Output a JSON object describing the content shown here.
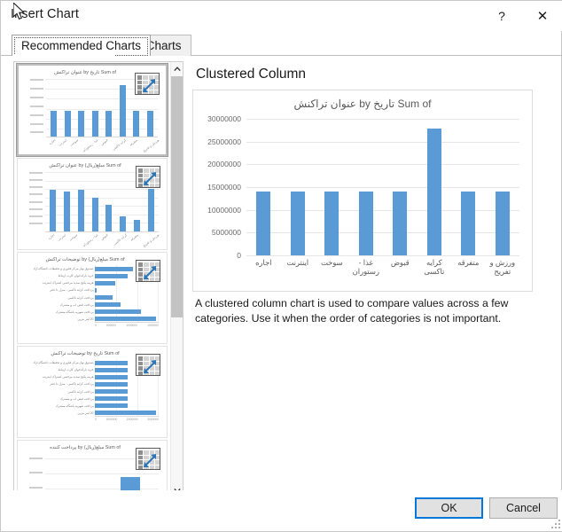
{
  "window": {
    "title": "Insert Chart",
    "help_label": "?",
    "close_label": "✕"
  },
  "tabs": [
    {
      "label": "Recommended Charts",
      "active": true
    },
    {
      "label": "All Charts",
      "active": false
    }
  ],
  "preview": {
    "heading": "Clustered Column",
    "description": "A clustered column chart is used to compare values across a few categories. Use it when the order of categories is not important."
  },
  "buttons": {
    "ok": "OK",
    "cancel": "Cancel"
  },
  "scrollbar": {
    "up_icon": "chevron-up-icon",
    "down_icon": "chevron-down-icon"
  },
  "thumbnails": [
    {
      "title": "Sum of تاریخ by عنوان تراکنش",
      "type": "column",
      "selected": true
    },
    {
      "title": "Sum of مبلغ(ریال) by عنوان تراکنش",
      "type": "column",
      "selected": false
    },
    {
      "title": "Sum of مبلغ(ریال) by توضیحات تراکنش",
      "type": "bar",
      "selected": false
    },
    {
      "title": "Sum of تاریخ by توضیحات تراکنش",
      "type": "bar",
      "selected": false
    },
    {
      "title": "Sum of مبلغ(ریال) by پرداخت کننده",
      "type": "column",
      "selected": false
    }
  ],
  "colors": {
    "series": "#5b9bd5",
    "accent": "#0078d7",
    "gridline": "#e6e6e6",
    "axis_text": "#6b6b6b"
  },
  "chart_data": {
    "type": "bar",
    "title": "Sum of تاریخ by عنوان تراکنش",
    "xlabel": "",
    "ylabel": "",
    "ylim": [
      0,
      30000000
    ],
    "ytick_labels": [
      "0",
      "5000000",
      "10000000",
      "15000000",
      "20000000",
      "25000000",
      "30000000"
    ],
    "ytick_values": [
      0,
      5000000,
      10000000,
      15000000,
      20000000,
      25000000,
      30000000
    ],
    "grid": true,
    "legend": false,
    "categories": [
      "اجاره",
      "اینترنت",
      "سوخت",
      "غذا - رستوران",
      "قبوض",
      "کرایه تاکسی",
      "متفرقه",
      "ورزش و تفریح"
    ],
    "values": [
      13950000,
      13950000,
      13950000,
      13950000,
      13950000,
      27800000,
      13950000,
      13950000
    ],
    "series": [
      {
        "name": "Sum of تاریخ",
        "values": [
          13950000,
          13950000,
          13950000,
          13950000,
          13950000,
          27800000,
          13950000,
          13950000
        ]
      }
    ],
    "thumbnail_charts": [
      {
        "title": "Sum of تاریخ by عنوان تراکنش",
        "type": "bar",
        "categories": [
          "اجاره",
          "اینترنت",
          "سوخت",
          "غذا - رستوران",
          "قبوض",
          "کرایه تاکسی",
          "متفرقه",
          "ورزش و تفریح"
        ],
        "values": [
          13950000,
          13950000,
          13950000,
          13950000,
          13950000,
          27800000,
          13950000,
          13950000
        ]
      },
      {
        "title": "Sum of مبلغ(ریال) by عنوان تراکنش",
        "type": "bar",
        "categories": [
          "اجاره",
          "اینترنت",
          "سوخت",
          "غذا - رستوران",
          "قبوض",
          "کرایه تاکسی",
          "متفرقه",
          "ورزش و تفریح"
        ],
        "values": [
          70,
          68,
          70,
          58,
          46,
          27,
          21,
          72
        ]
      },
      {
        "title": "Sum of مبلغ(ریال) by توضیحات تراکنش",
        "type": "bar",
        "orientation": "horizontal",
        "values": [
          60,
          52,
          32,
          3,
          28,
          40,
          72,
          96
        ]
      },
      {
        "title": "Sum of تاریخ by توضیحات تراکنش",
        "type": "bar",
        "orientation": "horizontal",
        "values": [
          52,
          52,
          52,
          52,
          52,
          52,
          52,
          96
        ]
      },
      {
        "title": "Sum of مبلغ(ریال) by پرداخت کننده",
        "type": "bar",
        "values": [
          22,
          62
        ]
      }
    ]
  }
}
